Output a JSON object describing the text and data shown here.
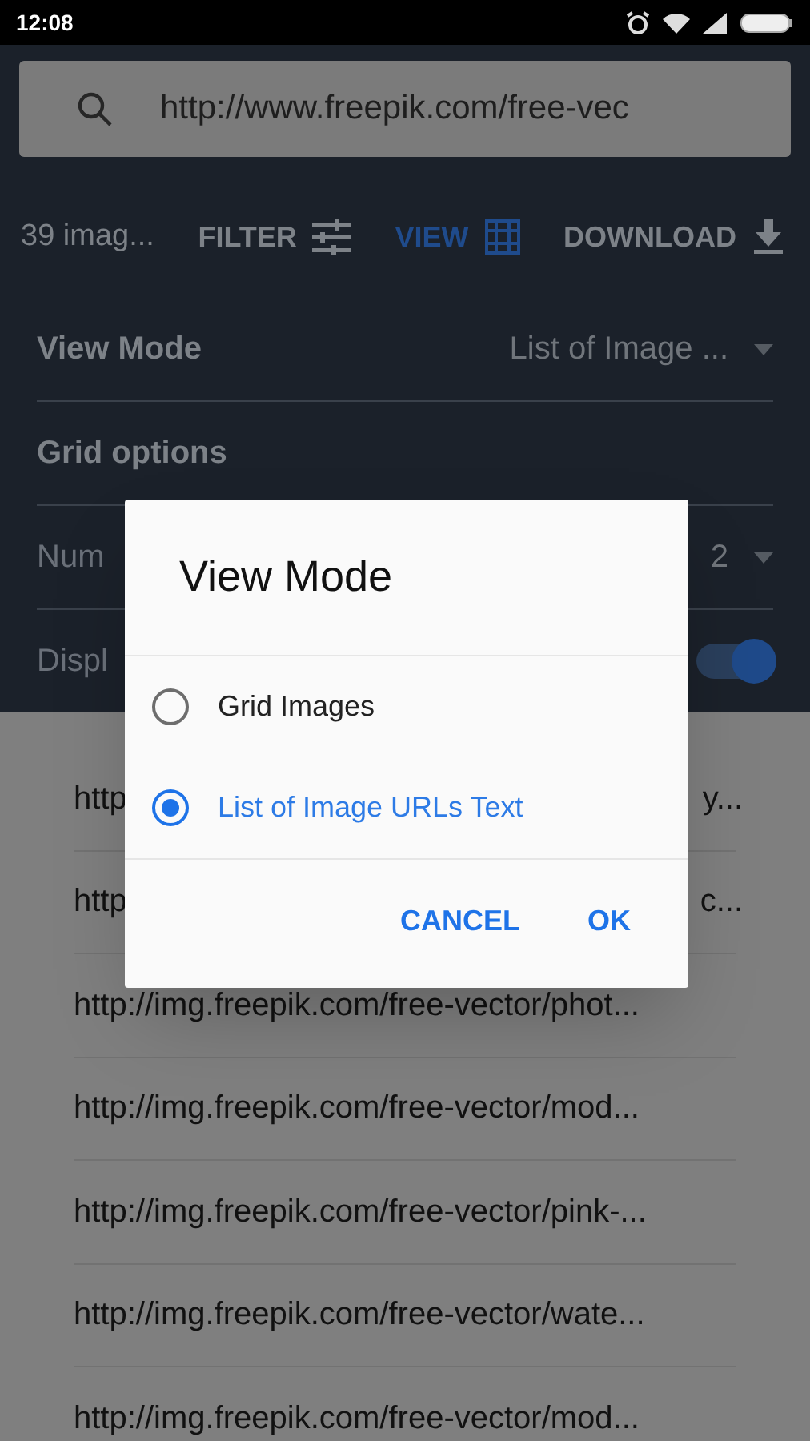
{
  "status_bar": {
    "time": "12:08"
  },
  "search": {
    "value": "http://www.freepik.com/free-vec"
  },
  "toolbar": {
    "count": "39 imag...",
    "actions": [
      {
        "kind": "filter",
        "label": "FILTER",
        "selected": false
      },
      {
        "kind": "view",
        "label": "VIEW",
        "selected": true
      },
      {
        "kind": "download",
        "label": "DOWNLOAD",
        "selected": false
      }
    ]
  },
  "settings": [
    {
      "kind": "dropdown",
      "label": "View Mode",
      "value": "List of Image ..."
    },
    {
      "kind": "header",
      "label": "Grid options"
    },
    {
      "kind": "dropdown",
      "label": "Num",
      "value": "2"
    },
    {
      "kind": "toggle",
      "label": "Displ",
      "on": true
    }
  ],
  "url_list": [
    {
      "start": "http",
      "end": "y..."
    },
    {
      "start": "http",
      "end": "c..."
    },
    {
      "start": "http://img.freepik.com/free-vector/phot..."
    },
    {
      "start": "http://img.freepik.com/free-vector/mod..."
    },
    {
      "start": "http://img.freepik.com/free-vector/pink-..."
    },
    {
      "start": "http://img.freepik.com/free-vector/wate..."
    },
    {
      "start": "http://img.freepik.com/free-vector/mod..."
    }
  ],
  "dialog": {
    "title": "View Mode",
    "options": [
      {
        "label": "Grid Images",
        "selected": false
      },
      {
        "label": "List of Image URLs Text",
        "selected": true
      }
    ],
    "buttons": [
      "CANCEL",
      "OK"
    ]
  }
}
